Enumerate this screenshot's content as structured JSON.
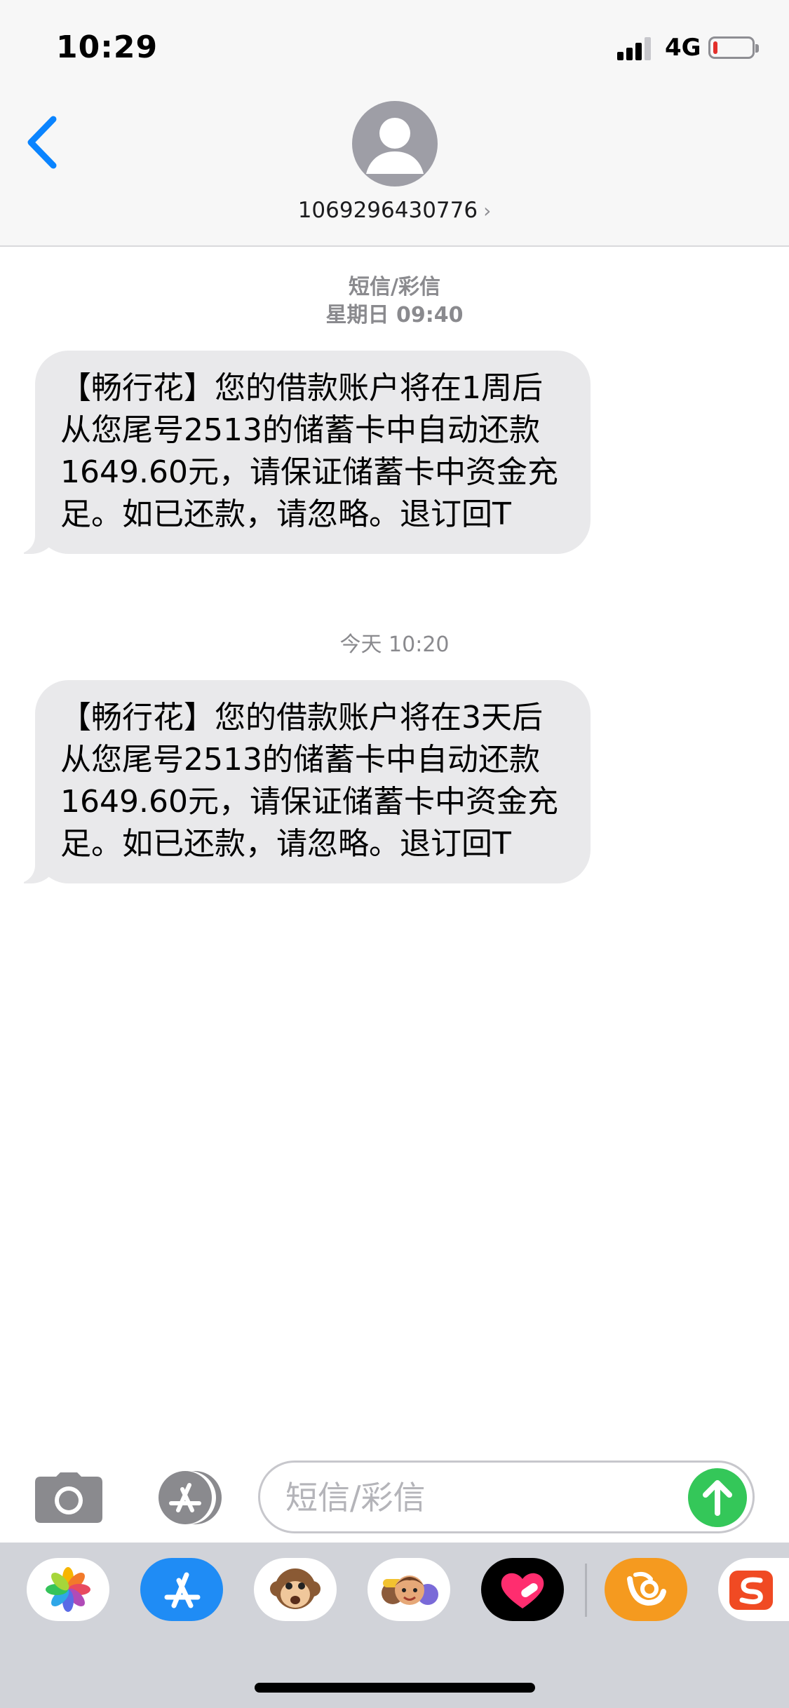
{
  "status_bar": {
    "time": "10:29",
    "network": "4G",
    "battery_level": 0.08,
    "battery_color": "#e3302b"
  },
  "header": {
    "back_icon": "chevron-left-icon",
    "avatar_icon": "person-silhouette-icon",
    "contact": "1069296430776",
    "contact_chevron": "›"
  },
  "thread": [
    {
      "meta_line1": "短信/彩信",
      "meta_line2": "星期日 09:40",
      "text": "【畅行花】您的借款账户将在1周后从您尾号2513的储蓄卡中自动还款1649.60元，请保证储蓄卡中资金充足。如已还款，请忽略。退订回T"
    },
    {
      "meta_line1": "今天 10:20",
      "text": "【畅行花】您的借款账户将在3天后从您尾号2513的储蓄卡中自动还款1649.60元，请保证储蓄卡中资金充足。如已还款，请忽略。退订回T"
    }
  ],
  "compose": {
    "camera_icon": "camera-icon",
    "apps_icon": "app-store-icon",
    "placeholder": "短信/彩信",
    "send_icon": "arrow-up-icon",
    "send_color": "#34c759"
  },
  "app_drawer": [
    {
      "name": "photos",
      "icon": "photos-icon"
    },
    {
      "name": "app-store",
      "icon": "app-store-icon"
    },
    {
      "name": "animoji",
      "icon": "monkey-animoji-icon"
    },
    {
      "name": "memoji-stickers",
      "icon": "memoji-icon"
    },
    {
      "name": "digital-touch",
      "icon": "heart-touch-icon"
    },
    {
      "name": "uc-browser",
      "icon": "uc-browser-icon"
    },
    {
      "name": "sogou-keyboard",
      "icon": "sogou-icon"
    }
  ]
}
